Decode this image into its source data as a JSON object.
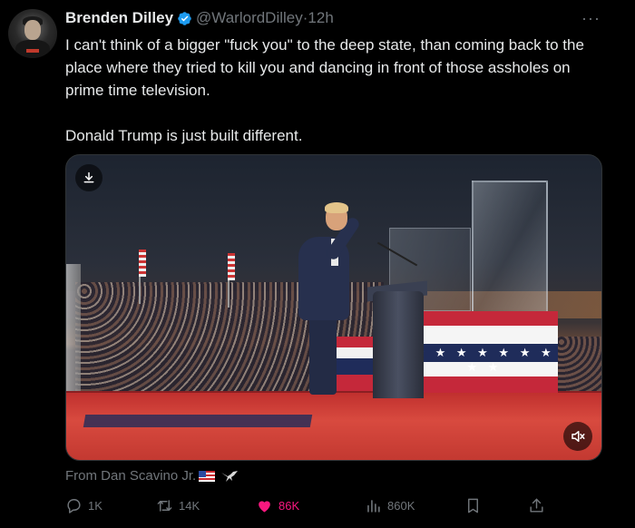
{
  "post": {
    "author_name": "Brenden Dilley",
    "handle": "@WarlordDilley",
    "separator": "·",
    "time": "12h",
    "more": "···",
    "text_line1": "I can't think of a bigger \"fuck you\" to the deep state, than coming back to the place where they tried to kill you and dancing in front of those assholes on prime time television.",
    "text_line2": "Donald Trump is just built different.",
    "media_source": "From Dan Scavino Jr.",
    "bunting_stars": "★ ★ ★ ★ ★ ★ ★ ★ ★"
  },
  "stats": {
    "replies": "1K",
    "reposts": "14K",
    "likes": "86K",
    "views": "860K"
  },
  "colors": {
    "background": "#000000",
    "text": "#e7e9ea",
    "muted": "#71767b",
    "verified": "#1d9bf0",
    "like": "#f91880"
  },
  "icons": [
    "verified-badge-icon",
    "more-icon",
    "download-icon",
    "mute-icon",
    "reply-icon",
    "repost-icon",
    "heart-icon",
    "views-icon",
    "bookmark-icon",
    "share-icon",
    "us-flag-icon",
    "eagle-icon"
  ]
}
